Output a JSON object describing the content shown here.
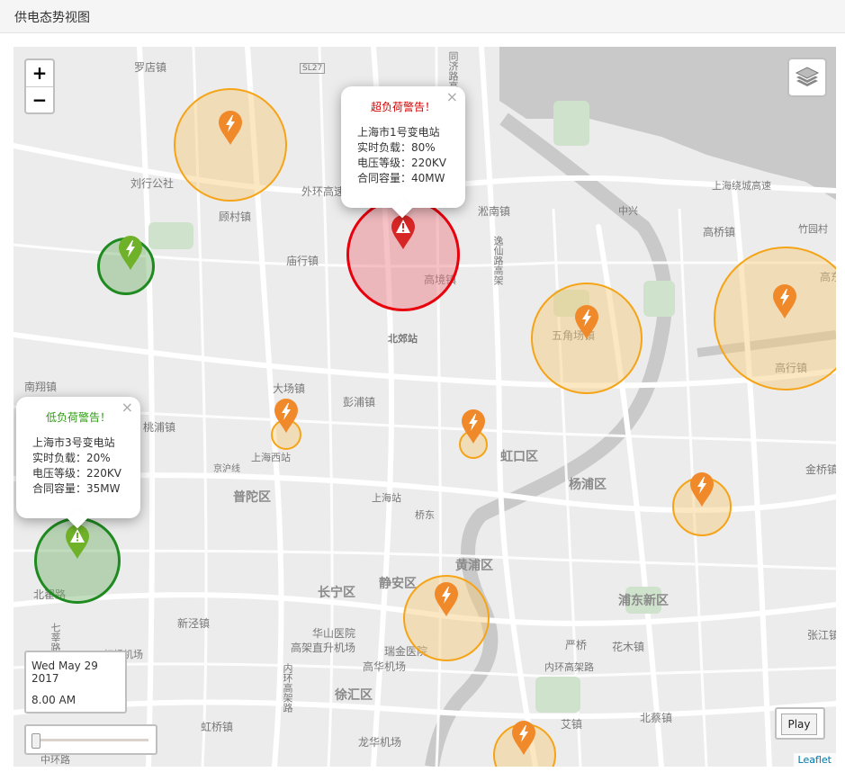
{
  "panel": {
    "title": "供电态势视图"
  },
  "map": {
    "zoom_in": "+",
    "zoom_out": "−",
    "attribution": "Leaflet",
    "play_label": "Play",
    "time_date": "Wed May 29 2017",
    "time_clock": "8.00 AM",
    "colors": {
      "overload": "#e8000c",
      "normal": "#f5a417",
      "underload": "#1e8a20"
    },
    "place_labels": [
      "罗店镇",
      "SL27",
      "同济路高架",
      "刘行公社",
      "顾村镇",
      "外环高速",
      "淞南镇",
      "中兴",
      "上海绕城高速",
      "高桥镇",
      "竹园村",
      "高东",
      "庙行镇",
      "高境镇",
      "逸仙路高架",
      "北郊站",
      "五角场镇",
      "高行镇",
      "南翔镇",
      "大场镇",
      "彭浦镇",
      "桃浦镇",
      "上海西站",
      "虹口区",
      "杨浦区",
      "金桥镇",
      "京沪线",
      "普陀区",
      "上海站",
      "桥东",
      "黄浦区",
      "北翟路",
      "长宁区",
      "静安区",
      "浦东新区",
      "新泾镇",
      "华山医院",
      "高架直升机场",
      "瑞金医院",
      "高华机场",
      "严桥",
      "花木镇",
      "张江镇",
      "内环高架路",
      "虹桥机场",
      "徐汇区",
      "内环高架路",
      "虹桥镇",
      "龙华机场",
      "艾镇",
      "北蔡镇",
      "中环路",
      "七莘路"
    ],
    "popups": [
      {
        "warning": "超负荷警告！",
        "station": "上海市1号变电站",
        "load": "实时负载：80%",
        "voltage": "电压等级：220KV",
        "capacity": "合同容量：40MW",
        "close": "×"
      },
      {
        "warning": "低负荷警告！",
        "station": "上海市3号变电站",
        "load": "实时负载：20%",
        "voltage": "电压等级：220KV",
        "capacity": "合同容量：35MW",
        "close": "×"
      }
    ],
    "marker_icons": {
      "normal": "lightning-icon",
      "warning": "warning-icon"
    }
  }
}
